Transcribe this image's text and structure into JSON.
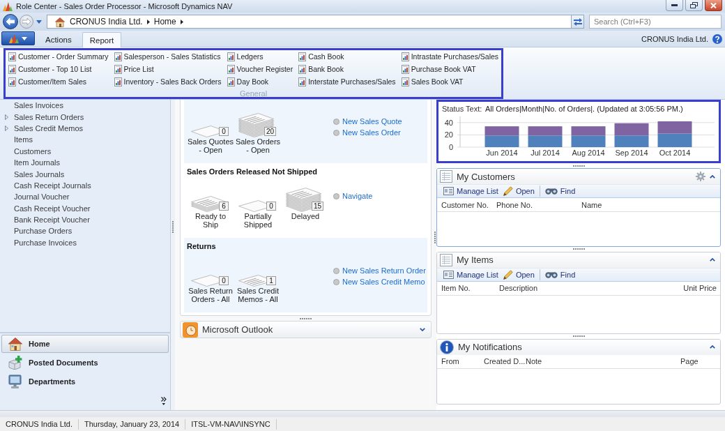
{
  "window": {
    "title": "Role Center - Sales Order Processor - Microsoft Dynamics NAV"
  },
  "address_bar": {
    "history_buttons": [
      {
        "kind": "back",
        "disabled": false
      },
      {
        "kind": "forward",
        "disabled": true
      }
    ],
    "breadcrumb": [
      "CRONUS India Ltd.",
      "Home"
    ],
    "search": {
      "placeholder": "Search (Ctrl+F3)"
    }
  },
  "ribbon": {
    "tabs": [
      {
        "label": "Actions",
        "selected": false
      },
      {
        "label": "Report",
        "selected": true
      }
    ],
    "company": "CRONUS India Ltd.",
    "groups": [
      {
        "label": "General",
        "highlighted": true,
        "items": [
          "Customer - Order Summary",
          "Customer - Top 10 List",
          "Customer/Item Sales",
          "Salesperson - Sales Statistics",
          "Price List",
          "Inventory - Sales Back Orders",
          "Ledgers",
          "Voucher Register",
          "Day Book",
          "Cash Book",
          "Bank Book",
          "Interstate Purchases/Sales",
          "Intrastate Purchases/Sales",
          "Purchase Book VAT",
          "Sales Book VAT"
        ]
      }
    ]
  },
  "navigation_pane": {
    "items": [
      {
        "label": "Sales Invoices",
        "expandable": false
      },
      {
        "label": "Sales Return Orders",
        "expandable": true
      },
      {
        "label": "Sales Credit Memos",
        "expandable": true
      },
      {
        "label": "Items",
        "expandable": false
      },
      {
        "label": "Customers",
        "expandable": false
      },
      {
        "label": "Item Journals",
        "expandable": false
      },
      {
        "label": "Sales Journals",
        "expandable": false
      },
      {
        "label": "Cash Receipt Journals",
        "expandable": false
      },
      {
        "label": "Journal Voucher",
        "expandable": false
      },
      {
        "label": "Cash Receipt Voucher",
        "expandable": false
      },
      {
        "label": "Bank Receipt Voucher",
        "expandable": false
      },
      {
        "label": "Purchase Orders",
        "expandable": false
      },
      {
        "label": "Purchase Invoices",
        "expandable": false
      }
    ],
    "buttons": [
      {
        "label": "Home",
        "selected": true
      },
      {
        "label": "Posted Documents",
        "selected": false
      },
      {
        "label": "Departments",
        "selected": false
      }
    ]
  },
  "activities": {
    "sections": [
      {
        "cues": [
          {
            "label": "Sales Quotes\n- Open",
            "count": "0",
            "kind": "empty"
          },
          {
            "label": "Sales Orders\n- Open",
            "count": "20",
            "kind": "many"
          }
        ],
        "actions": [
          "New Sales Quote",
          "New Sales Order"
        ]
      },
      {
        "title": "Sales Orders Released Not Shipped",
        "cues": [
          {
            "label": "Ready to\nShip",
            "count": "6",
            "kind": "few"
          },
          {
            "label": "Partially\nShipped",
            "count": "0",
            "kind": "empty"
          },
          {
            "label": "Delayed",
            "count": "15",
            "kind": "many"
          }
        ],
        "actions": [
          "Navigate"
        ]
      },
      {
        "title": "Returns",
        "cues": [
          {
            "label": "Sales Return\nOrders - All",
            "count": "0",
            "kind": "empty"
          },
          {
            "label": "Sales Credit\nMemos - All",
            "count": "1",
            "kind": "single"
          }
        ],
        "actions": [
          "New Sales Return Order",
          "New Sales Credit Memo"
        ]
      }
    ]
  },
  "outlook": {
    "title": "Microsoft Outlook",
    "expanded": false
  },
  "parts": [
    {
      "kind": "chart",
      "highlighted": true,
      "status_label": "Status Text:",
      "status_text": "All Orders|Month|No. of Orders|. (Updated at 3:05:56 PM.)",
      "chart_data": {
        "type": "bar",
        "categories": [
          "Jun 2014",
          "Jul 2014",
          "Aug 2014",
          "Sep 2014",
          "Oct 2014"
        ],
        "series": [
          {
            "color": "#4f81bd",
            "values": [
              19,
              19,
              19,
              19,
              22
            ]
          },
          {
            "color": "#8064a2",
            "values": [
              15,
              15,
              15,
              20,
              20
            ]
          }
        ],
        "stacked": true,
        "yticks": [
          0,
          20,
          40
        ],
        "ylim": [
          0,
          50
        ]
      }
    },
    {
      "kind": "list",
      "title": "My Customers",
      "focused": true,
      "expanded": true,
      "settings": true,
      "actions": [
        "Manage List",
        "Open",
        "Find"
      ],
      "columns": [
        "Customer No.",
        "Phone No.",
        "Name"
      ]
    },
    {
      "kind": "list",
      "title": "My Items",
      "focused": false,
      "expanded": true,
      "settings": false,
      "actions": [
        "Manage List",
        "Open",
        "Find"
      ],
      "columns": [
        "Item No.",
        "Description",
        "Unit Price"
      ]
    },
    {
      "kind": "notes",
      "title": "My Notifications",
      "focused": false,
      "expanded": true,
      "settings": false,
      "columns": [
        "From",
        "Created D...",
        "Note",
        "Page"
      ]
    }
  ],
  "status_bar": [
    "CRONUS India Ltd.",
    "Thursday, January 23, 2014",
    "ITSL-VM-NAV\\INSYNC"
  ]
}
